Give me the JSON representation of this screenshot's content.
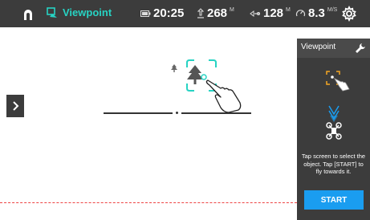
{
  "topbar": {
    "mode_label": "Viewpoint",
    "battery_time": "20:25",
    "altitude": {
      "value": "268",
      "unit": "M"
    },
    "distance": {
      "value": "128",
      "unit": "M"
    },
    "speed": {
      "value": "8.3",
      "unit": "M/S"
    }
  },
  "panel": {
    "title": "Viewpoint",
    "instructions": "Tap screen to select the object. Tap [START] to fly towards it.",
    "start_label": "START"
  },
  "colors": {
    "accent": "#27d3c3",
    "start_button": "#1a9df0",
    "bar_bg": "#3c3c3c",
    "dashed_line": "#ee4444"
  },
  "icons": {
    "home": "arch-home-icon",
    "mode": "viewpoint-mode-icon",
    "battery": "battery-icon",
    "altitude": "altitude-icon",
    "distance": "distance-icon",
    "speed": "speedometer-icon",
    "settings": "gear-icon",
    "expand": "chevron-right-icon",
    "wrench": "wrench-icon",
    "select_target": "select-target-icon",
    "drone": "drone-icon"
  }
}
